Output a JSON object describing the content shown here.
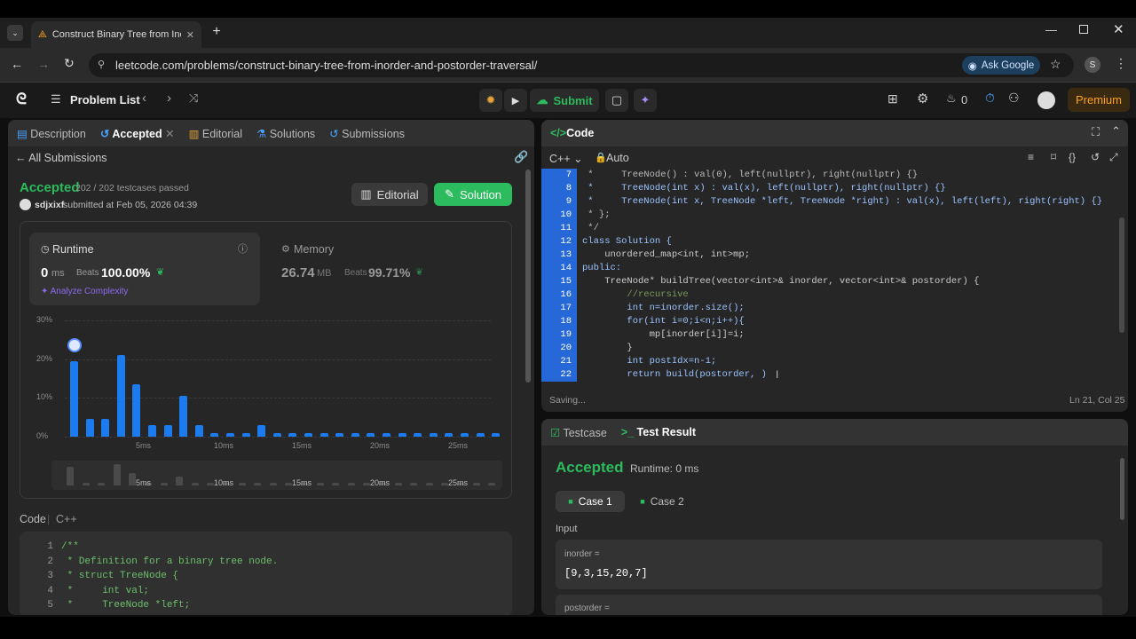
{
  "browser": {
    "tab_title": "Construct Binary Tree from Inor",
    "url": "leetcode.com/problems/construct-binary-tree-from-inorder-and-postorder-traversal/",
    "ask_google": "Ask Google",
    "profile": "S"
  },
  "nav": {
    "problem_list": "Problem List",
    "submit": "Submit",
    "streak": "0",
    "premium": "Premium"
  },
  "left_tabs": {
    "description": "Description",
    "accepted": "Accepted",
    "editorial": "Editorial",
    "solutions": "Solutions",
    "submissions": "Submissions"
  },
  "submission": {
    "back": "All Submissions",
    "status": "Accepted",
    "passed": "202 / 202 testcases passed",
    "user": "sdjxixf",
    "submitted": "submitted at Feb 05, 2026 04:39",
    "editorial_btn": "Editorial",
    "solution_btn": "Solution"
  },
  "runtime": {
    "title": "Runtime",
    "value": "0",
    "unit": "ms",
    "beats_label": "Beats",
    "beats": "100.00%",
    "analyze": "Analyze Complexity"
  },
  "memory": {
    "title": "Memory",
    "value": "26.74",
    "unit": "MB",
    "beats_label": "Beats",
    "beats": "99.71%"
  },
  "chart_data": {
    "type": "bar",
    "xlabel": "",
    "ylabel": "",
    "ytick_labels": [
      "30%",
      "20%",
      "10%",
      "0%"
    ],
    "xtick_labels": [
      "5ms",
      "10ms",
      "15ms",
      "20ms",
      "25ms"
    ],
    "ylim": [
      0,
      30
    ],
    "values": [
      19.5,
      4.5,
      4.5,
      21,
      13.5,
      3,
      3,
      10.5,
      3,
      1,
      1,
      1,
      3,
      1,
      1,
      1,
      1,
      1,
      1,
      1,
      1,
      1,
      1,
      1,
      1,
      1,
      1,
      1
    ],
    "mini_values": [
      6,
      1,
      1,
      7,
      4,
      1,
      1,
      3,
      1,
      1,
      1,
      1,
      1,
      1,
      1,
      1,
      1,
      1,
      1,
      1,
      1,
      1,
      1,
      1,
      1,
      1,
      1,
      1
    ],
    "highlight_index": 0
  },
  "code_section": {
    "label": "Code",
    "lang": "C++",
    "lines": [
      "/**",
      " * Definition for a binary tree node.",
      " * struct TreeNode {",
      " *     int val;",
      " *     TreeNode *left;"
    ]
  },
  "editor": {
    "title": "Code",
    "lang": "C++",
    "mode": "Auto",
    "status": "Saving...",
    "cursor": "Ln 21, Col 25",
    "lines": [
      {
        "n": "7",
        "t": " *     TreeNode() : val(0), left(nullptr), right(nullptr) {}"
      },
      {
        "n": "8",
        "t": " *     TreeNode(int x) : val(x), left(nullptr), right(nullptr) {}"
      },
      {
        "n": "9",
        "t": " *     TreeNode(int x, TreeNode *left, TreeNode *right) : val(x), left(left), right(right) {}"
      },
      {
        "n": "10",
        "t": " * };"
      },
      {
        "n": "11",
        "t": " */"
      },
      {
        "n": "12",
        "t": "class Solution {"
      },
      {
        "n": "13",
        "t": "    unordered_map<int, int>mp;"
      },
      {
        "n": "14",
        "t": "public:"
      },
      {
        "n": "15",
        "t": "    TreeNode* buildTree(vector<int>& inorder, vector<int>& postorder) {"
      },
      {
        "n": "16",
        "t": "        //recursive"
      },
      {
        "n": "17",
        "t": "        int n=inorder.size();"
      },
      {
        "n": "18",
        "t": "        for(int i=0;i<n;i++){"
      },
      {
        "n": "19",
        "t": "            mp[inorder[i]]=i;"
      },
      {
        "n": "20",
        "t": "        }"
      },
      {
        "n": "21",
        "t": "        int postIdx=n-1;"
      },
      {
        "n": "22",
        "t": "        return build(postorder, )"
      }
    ]
  },
  "result": {
    "testcase_tab": "Testcase",
    "result_tab": "Test Result",
    "status": "Accepted",
    "runtime": "Runtime: 0 ms",
    "case1": "Case 1",
    "case2": "Case 2",
    "input_label": "Input",
    "inorder_label": "inorder =",
    "inorder_value": "[9,3,15,20,7]",
    "postorder_label": "postorder ="
  },
  "colors": {
    "accent_green": "#2cbb5d",
    "accent_blue": "#1d7bf0",
    "premium": "#ffa116"
  }
}
